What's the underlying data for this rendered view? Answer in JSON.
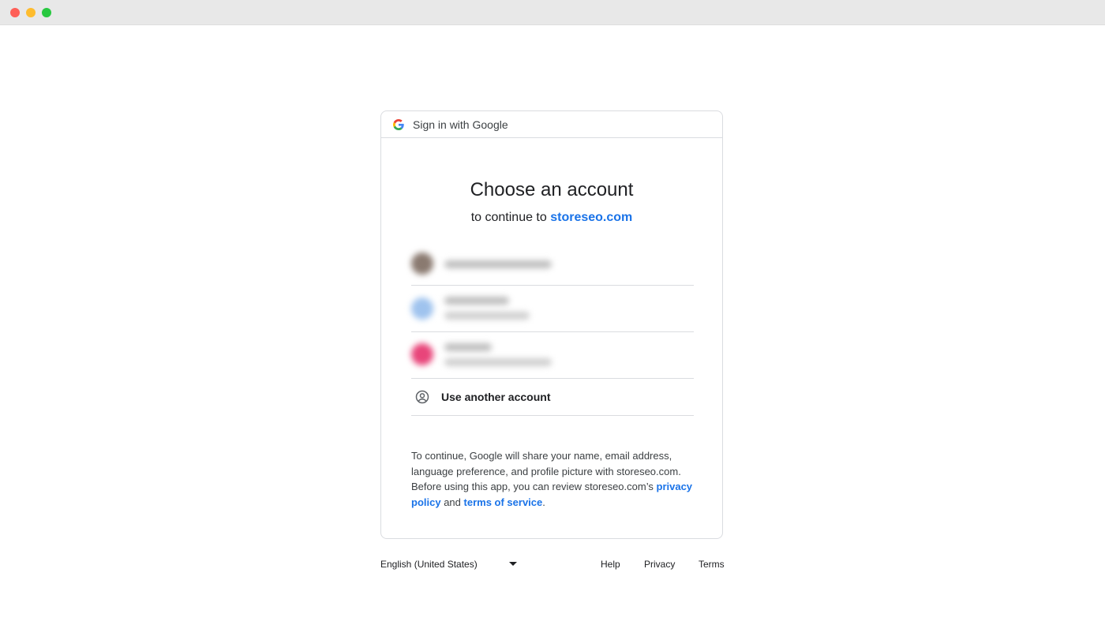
{
  "header": {
    "label": "Sign in with Google"
  },
  "main": {
    "title": "Choose an account",
    "subtitle_prefix": "to continue to",
    "site": "storeseo.com"
  },
  "accounts": [
    {
      "avatar_color": "#8a7a70",
      "name": "",
      "email": ""
    },
    {
      "avatar_color": "#9fc3ee",
      "name": "",
      "email": ""
    },
    {
      "avatar_color": "#e8457a",
      "name": "",
      "email": ""
    }
  ],
  "use_another": {
    "label": "Use another account",
    "icon": "account-circle-icon"
  },
  "disclaimer": {
    "text": "To continue, Google will share your name, email address, language preference, and profile picture with storeseo.com. Before using this app, you can review storeseo.com’s",
    "privacy_link": "privacy policy",
    "and": "and",
    "terms_link": "terms of service",
    "end": "."
  },
  "footer": {
    "language": "English (United States)",
    "help": "Help",
    "privacy": "Privacy",
    "terms": "Terms"
  },
  "colors": {
    "link": "#1a73e8",
    "border": "#dadce0"
  }
}
